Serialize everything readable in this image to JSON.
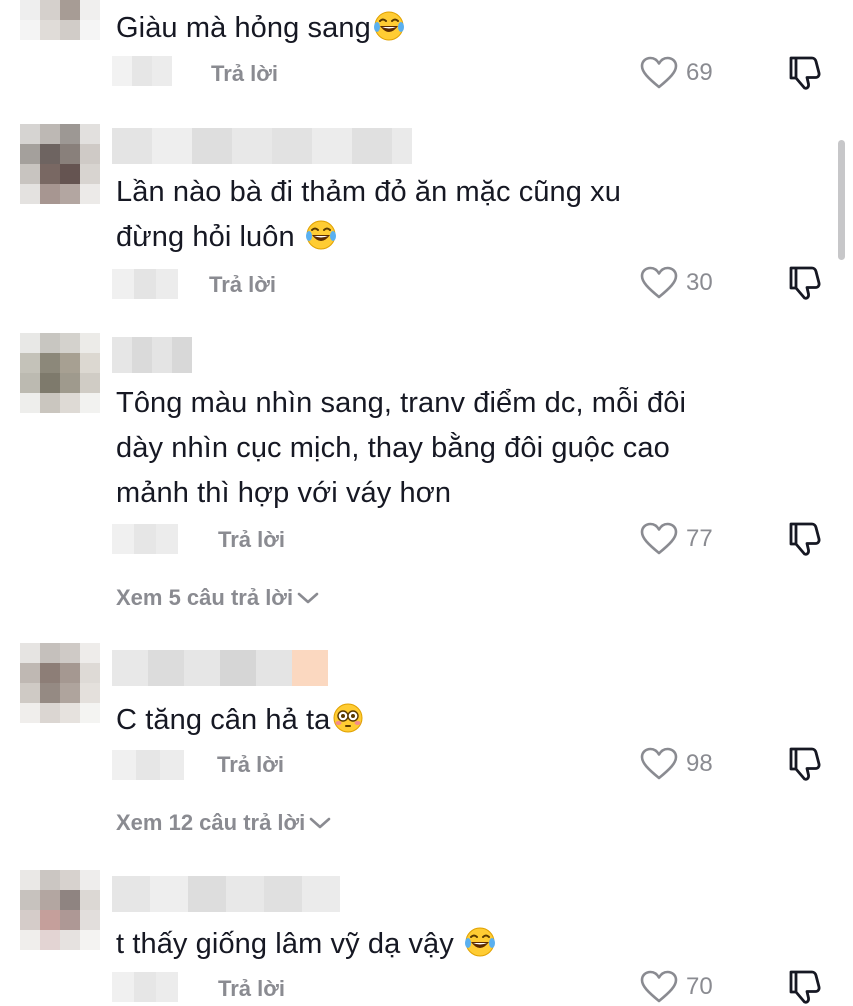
{
  "reply_label": "Trả lời",
  "comments": [
    {
      "text_lines": [
        "Giàu mà hỏng sang"
      ],
      "emoji": "laughing-tears",
      "likes": "69"
    },
    {
      "text_lines": [
        "Lần nào bà đi thảm đỏ ăn mặc cũng xu",
        "đừng hỏi luôn "
      ],
      "emoji": "laughing-tears",
      "likes": "30"
    },
    {
      "text_lines": [
        "Tông màu nhìn sang, tranv điểm dc, mỗi đôi",
        "dày nhìn cục mịch, thay bằng đôi guộc cao",
        "mảnh thì hợp với váy hơn"
      ],
      "emoji": "",
      "likes": "77",
      "view_replies": "Xem 5 câu trả lời"
    },
    {
      "text_lines": [
        "C tăng cân hả ta"
      ],
      "emoji": "flushed",
      "likes": "98",
      "view_replies": "Xem 12 câu trả lời"
    },
    {
      "text_lines": [
        "t thấy giống lâm vỹ dạ vậy "
      ],
      "emoji": "laughing-tears",
      "likes": "70"
    }
  ],
  "icons": {
    "like": "heart-outline-icon",
    "dislike": "thumbs-down-icon",
    "expand": "chevron-down-icon"
  },
  "colors": {
    "text": "#161823",
    "secondary": "#8a8b91",
    "background": "#ffffff"
  }
}
